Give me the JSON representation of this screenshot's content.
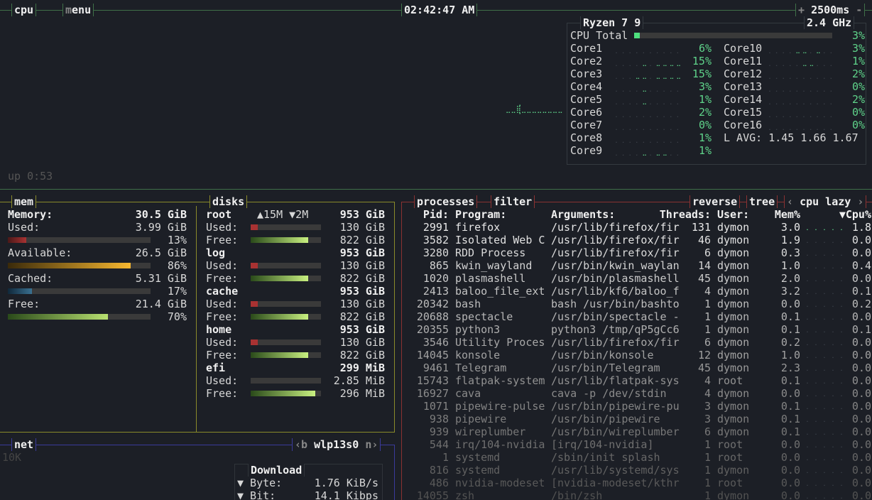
{
  "top": {
    "cpu_tab": "cpu",
    "menu_tab_hotkey": "m",
    "menu_tab_rest": "enu",
    "clock": "02:42:47 AM",
    "plus": "+",
    "interval": "2500ms",
    "minus": "-",
    "uptime": "up 0:53"
  },
  "cpu": {
    "model": "Ryzen 7 9",
    "freq": "2.4 GHz",
    "total_label": "CPU Total",
    "total_pct": "3%",
    "total_value": 3,
    "cores": [
      {
        "label": "Core1",
        "pct": "6%"
      },
      {
        "label": "Core2",
        "pct": "15%"
      },
      {
        "label": "Core3",
        "pct": "15%"
      },
      {
        "label": "Core4",
        "pct": "3%"
      },
      {
        "label": "Core5",
        "pct": "1%"
      },
      {
        "label": "Core6",
        "pct": "2%"
      },
      {
        "label": "Core7",
        "pct": "0%"
      },
      {
        "label": "Core8",
        "pct": "1%"
      },
      {
        "label": "Core9",
        "pct": "1%"
      },
      {
        "label": "Core10",
        "pct": "3%"
      },
      {
        "label": "Core11",
        "pct": "1%"
      },
      {
        "label": "Core12",
        "pct": "2%"
      },
      {
        "label": "Core13",
        "pct": "0%"
      },
      {
        "label": "Core14",
        "pct": "2%"
      },
      {
        "label": "Core15",
        "pct": "0%"
      },
      {
        "label": "Core16",
        "pct": "0%"
      }
    ],
    "load_avg": "L AVG: 1.45 1.66 1.67"
  },
  "mem": {
    "title": "mem",
    "total_label": "Memory:",
    "total_value": "30.5 GiB",
    "rows": [
      {
        "label": "Used:",
        "value": "3.99 GiB",
        "pct": "13%",
        "fill": 13
      },
      {
        "label": "Available:",
        "value": "26.5 GiB",
        "pct": "86%",
        "fill": 86
      },
      {
        "label": "Cached:",
        "value": "5.31 GiB",
        "pct": "17%",
        "fill": 17
      },
      {
        "label": "Free:",
        "value": "21.4 GiB",
        "pct": "70%",
        "fill": 70
      }
    ]
  },
  "disks": {
    "title": "disks",
    "io": "▲15M ▼2M",
    "items": [
      {
        "name": "root",
        "total": "953 GiB",
        "used": "130 GiB",
        "free": "822 GiB",
        "used_pct": 14,
        "free_pct": 86
      },
      {
        "name": "log",
        "total": "953 GiB",
        "used": "130 GiB",
        "free": "822 GiB",
        "used_pct": 14,
        "free_pct": 86
      },
      {
        "name": "cache",
        "total": "953 GiB",
        "used": "130 GiB",
        "free": "822 GiB",
        "used_pct": 14,
        "free_pct": 86
      },
      {
        "name": "home",
        "total": "953 GiB",
        "used": "130 GiB",
        "free": "822 GiB",
        "used_pct": 14,
        "free_pct": 86
      },
      {
        "name": "efi",
        "total": "299 MiB",
        "used": "2.85 MiB",
        "free": "296 MiB",
        "used_pct": 1,
        "free_pct": 99
      }
    ],
    "used_label": "Used:",
    "free_label": "Free:"
  },
  "net": {
    "title": "net",
    "prev_key": "‹b",
    "interface": "wlp13s0",
    "next_key": "n›",
    "scale": "10K",
    "download_title": "Download",
    "byte_label": "▼ Byte:",
    "byte_value": "1.76 KiB/s",
    "bit_label": "▼ Bit:",
    "bit_value": "14.1 Kibps"
  },
  "processes": {
    "title": "processes",
    "filter": "filter",
    "reverse": "reverse",
    "tree": "tree",
    "sort_prev": "‹",
    "sort": "cpu lazy",
    "sort_next": "›",
    "headers": {
      "pid": "Pid:",
      "program": "Program:",
      "args": "Arguments:",
      "threads": "Threads:",
      "user": "User:",
      "mem": "Mem%",
      "cpu": "▼Cpu%"
    },
    "rows": [
      [
        "2991",
        "firefox",
        "/usr/lib/firefox/fir",
        "131",
        "dymon",
        "3.0",
        "1.8"
      ],
      [
        "3582",
        "Isolated Web C",
        "/usr/lib/firefox/fir",
        "46",
        "dymon",
        "1.9",
        "0.0"
      ],
      [
        "3280",
        "RDD Process",
        "/usr/lib/firefox/fir",
        "6",
        "dymon",
        "0.3",
        "0.0"
      ],
      [
        "865",
        "kwin_wayland",
        "/usr/bin/kwin_waylan",
        "14",
        "dymon",
        "1.0",
        "0.4"
      ],
      [
        "1020",
        "plasmashell",
        "/usr/bin/plasmashell",
        "45",
        "dymon",
        "2.0",
        "0.0"
      ],
      [
        "2413",
        "baloo_file_ext",
        "/usr/lib/kf6/baloo_f",
        "4",
        "dymon",
        "3.2",
        "0.1"
      ],
      [
        "20342",
        "bash",
        "bash /usr/bin/bashto",
        "1",
        "dymon",
        "0.0",
        "0.2"
      ],
      [
        "20688",
        "spectacle",
        "/usr/bin/spectacle -",
        "1",
        "dymon",
        "0.1",
        "0.0"
      ],
      [
        "20355",
        "python3",
        "python3 /tmp/qP5gCc6",
        "1",
        "dymon",
        "0.1",
        "0.1"
      ],
      [
        "3546",
        "Utility Proces",
        "/usr/lib/firefox/fir",
        "6",
        "dymon",
        "0.2",
        "0.0"
      ],
      [
        "14045",
        "konsole",
        "/usr/bin/konsole",
        "12",
        "dymon",
        "1.0",
        "0.0"
      ],
      [
        "9461",
        "Telegram",
        "/usr/bin/Telegram",
        "45",
        "dymon",
        "2.3",
        "0.0"
      ],
      [
        "15743",
        "flatpak-system",
        "/usr/lib/flatpak-sys",
        "4",
        "root",
        "0.1",
        "0.0"
      ],
      [
        "16927",
        "cava",
        "cava -p /dev/stdin",
        "4",
        "dymon",
        "0.0",
        "0.0"
      ],
      [
        "1071",
        "pipewire-pulse",
        "/usr/bin/pipewire-pu",
        "3",
        "dymon",
        "0.1",
        "0.0"
      ],
      [
        "938",
        "pipewire",
        "/usr/bin/pipewire",
        "3",
        "dymon",
        "0.1",
        "0.0"
      ],
      [
        "939",
        "wireplumber",
        "/usr/bin/wireplumber",
        "6",
        "dymon",
        "0.1",
        "0.0"
      ],
      [
        "544",
        "irq/104-nvidia",
        "[irq/104-nvidia]",
        "1",
        "root",
        "0.0",
        "0.0"
      ],
      [
        "1",
        "systemd",
        "/sbin/init splash",
        "1",
        "root",
        "0.0",
        "0.0"
      ],
      [
        "816",
        "systemd",
        "/usr/lib/systemd/sys",
        "1",
        "dymon",
        "0.0",
        "0.0"
      ],
      [
        "486",
        "nvidia-modeset",
        "[nvidia-modeset/kthr",
        "1",
        "root",
        "0.0",
        "0.0"
      ],
      [
        "14055",
        "zsh",
        "/bin/zsh",
        "1",
        "dymon",
        "0.0",
        "0.0"
      ]
    ]
  },
  "colors": {
    "background": "#1c1f26",
    "cpu_border": "#3f7048",
    "mem_border": "#8a8a2a",
    "net_border": "#3a3a9a",
    "proc_border": "#8a3232",
    "accent_green": "#5fd38a"
  }
}
